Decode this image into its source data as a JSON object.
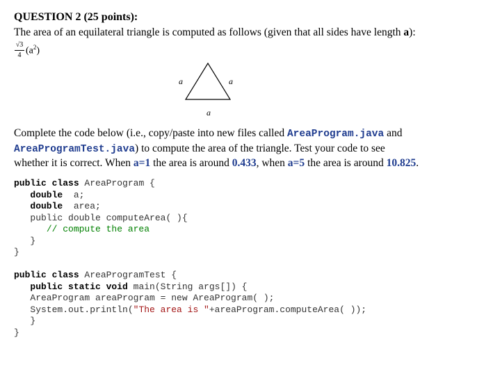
{
  "question": {
    "title": "QUESTION 2 (25 points):",
    "intro_prefix": "The area of an equilateral triangle is computed as follows (given that all sides have length ",
    "intro_var": "a",
    "intro_suffix": "):"
  },
  "formula": {
    "numerator": "√3",
    "denominator": "4",
    "term": "(a",
    "exponent": "2",
    "close": ")"
  },
  "triangle": {
    "side_left": "a",
    "side_right": "a",
    "side_bottom": "a"
  },
  "instructions": {
    "l1_a": "Complete the code below (i.e., copy/paste into new files called ",
    "file1": "AreaProgram.java",
    "l1_b": " and",
    "file2": "AreaProgramTest.java",
    "l2_b": ") to compute the area of the triangle.   Test your code to see",
    "l3_a": "whether it is correct.   When ",
    "cond1": "a=1",
    "l3_b": " the area is around ",
    "val1": "0.433",
    "l3_c": ", when ",
    "cond2": "a=5",
    "l3_d": " the area is around ",
    "val2": "10.825",
    "l3_e": "."
  },
  "code1": {
    "l1_kw": "public class",
    "l1_rest": " AreaProgram {",
    "l2_kw": "double",
    "l2_rest": "  a;",
    "l3_kw": "double",
    "l3_rest": "  area;",
    "l4": "public double computeArea( ){",
    "l5": "// compute the area",
    "l6": "}",
    "l7": "}"
  },
  "code2": {
    "l1_kw": "public class",
    "l1_rest": " AreaProgramTest {",
    "l2_kw": "public static void",
    "l2_rest": " main(String args[]) {",
    "l3": "AreaProgram areaProgram = new AreaProgram( );",
    "l4_a": "System.out.println(",
    "l4_str": "\"The area is \"",
    "l4_b": "+areaProgram.computeArea( ));",
    "l5": "}",
    "l6": "}"
  }
}
